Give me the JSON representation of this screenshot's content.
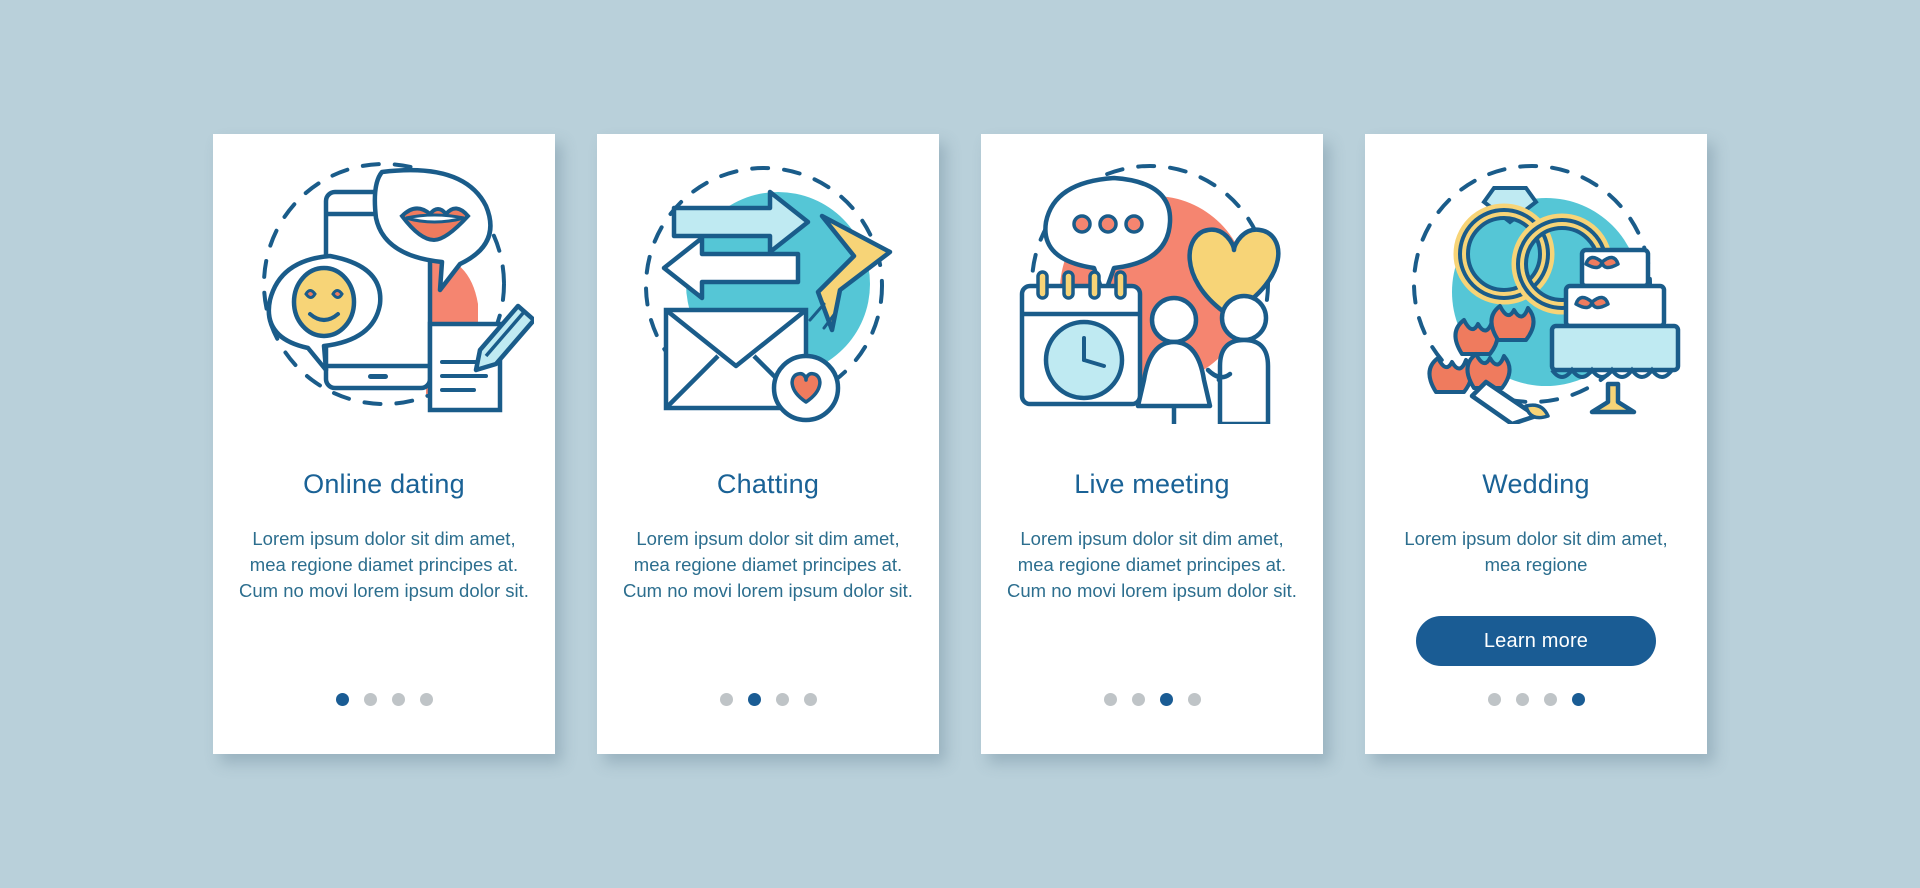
{
  "theme": {
    "background": "#b9d0da",
    "card_background": "#ffffff",
    "title_color": "#1a6296",
    "body_color": "#2c6e8e",
    "accent_blue": "#1a5c94",
    "dot_inactive": "#bfc4c7",
    "teal": "#55c6d6",
    "teal_light": "#bfeaf2",
    "salmon": "#f58570",
    "coral": "#ef7b5e",
    "yellow": "#f7d477",
    "stroke": "#1a5c8a"
  },
  "screens": [
    {
      "id": "online-dating",
      "title": "Online dating",
      "body": "Lorem ipsum dolor sit dim amet, mea regione diamet principes at. Cum no movi lorem ipsum dolor sit.",
      "illustration": "phone-chat-bubbles-icon",
      "dots": {
        "count": 4,
        "active_index": 0
      },
      "button": null
    },
    {
      "id": "chatting",
      "title": "Chatting",
      "body": "Lorem ipsum dolor sit dim amet, mea regione diamet principes at. Cum no movi lorem ipsum dolor sit.",
      "illustration": "envelope-arrows-icon",
      "dots": {
        "count": 4,
        "active_index": 1
      },
      "button": null
    },
    {
      "id": "live-meeting",
      "title": "Live meeting",
      "body": "Lorem ipsum dolor sit dim amet, mea regione diamet principes at. Cum no movi lorem ipsum dolor sit.",
      "illustration": "calendar-couple-heart-icon",
      "dots": {
        "count": 4,
        "active_index": 2
      },
      "button": null
    },
    {
      "id": "wedding",
      "title": "Wedding",
      "body": "Lorem ipsum dolor sit dim amet, mea regione",
      "illustration": "rings-cake-flowers-icon",
      "dots": {
        "count": 4,
        "active_index": 3
      },
      "button": {
        "label": "Learn more"
      }
    }
  ]
}
